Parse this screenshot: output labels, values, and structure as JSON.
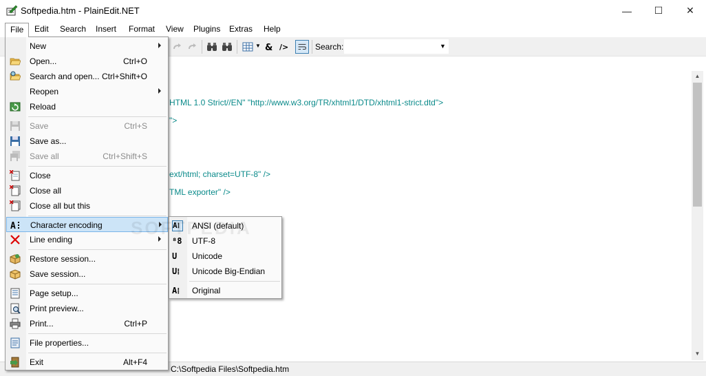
{
  "window": {
    "title": "Softpedia.htm - PlainEdit.NET",
    "minimize": "—",
    "maximize": "☐",
    "close": "✕"
  },
  "menubar": [
    "File",
    "Edit",
    "Search",
    "Insert",
    "Format",
    "View",
    "Plugins",
    "Extras",
    "Help"
  ],
  "toolbar": {
    "search_label": "Search:",
    "search_value": ""
  },
  "file_menu": {
    "items": [
      {
        "label": "New",
        "shortcut": "",
        "submenu": true,
        "disabled": false,
        "icon": "none"
      },
      {
        "label": "Open...",
        "shortcut": "Ctrl+O",
        "submenu": false,
        "disabled": false,
        "icon": "folder-open-icon"
      },
      {
        "label": "Search and open...",
        "shortcut": "Ctrl+Shift+O",
        "submenu": false,
        "disabled": false,
        "icon": "folder-search-icon"
      },
      {
        "label": "Reopen",
        "shortcut": "",
        "submenu": true,
        "disabled": false,
        "icon": "none"
      },
      {
        "label": "Reload",
        "shortcut": "",
        "submenu": false,
        "disabled": false,
        "icon": "reload-icon"
      },
      {
        "label": "Save",
        "shortcut": "Ctrl+S",
        "submenu": false,
        "disabled": true,
        "icon": "save-icon"
      },
      {
        "label": "Save as...",
        "shortcut": "",
        "submenu": false,
        "disabled": false,
        "icon": "save-as-icon"
      },
      {
        "label": "Save all",
        "shortcut": "Ctrl+Shift+S",
        "submenu": false,
        "disabled": true,
        "icon": "save-all-icon"
      },
      {
        "label": "Close",
        "shortcut": "",
        "submenu": false,
        "disabled": false,
        "icon": "close-doc-icon"
      },
      {
        "label": "Close all",
        "shortcut": "",
        "submenu": false,
        "disabled": false,
        "icon": "close-all-icon"
      },
      {
        "label": "Close all but this",
        "shortcut": "",
        "submenu": false,
        "disabled": false,
        "icon": "close-others-icon"
      },
      {
        "label": "Character encoding",
        "shortcut": "",
        "submenu": true,
        "disabled": false,
        "icon": "encoding-icon"
      },
      {
        "label": "Line ending",
        "shortcut": "",
        "submenu": true,
        "disabled": false,
        "icon": "line-ending-icon"
      },
      {
        "label": "Restore session...",
        "shortcut": "",
        "submenu": false,
        "disabled": false,
        "icon": "restore-session-icon"
      },
      {
        "label": "Save session...",
        "shortcut": "",
        "submenu": false,
        "disabled": false,
        "icon": "save-session-icon"
      },
      {
        "label": "Page setup...",
        "shortcut": "",
        "submenu": false,
        "disabled": false,
        "icon": "page-setup-icon"
      },
      {
        "label": "Print preview...",
        "shortcut": "",
        "submenu": false,
        "disabled": false,
        "icon": "print-preview-icon"
      },
      {
        "label": "Print...",
        "shortcut": "Ctrl+P",
        "submenu": false,
        "disabled": false,
        "icon": "print-icon"
      },
      {
        "label": "File properties...",
        "shortcut": "",
        "submenu": false,
        "disabled": false,
        "icon": "file-properties-icon"
      },
      {
        "label": "Exit",
        "shortcut": "Alt+F4",
        "submenu": false,
        "disabled": false,
        "icon": "exit-icon"
      }
    ]
  },
  "encoding_menu": {
    "items": [
      {
        "label": "ANSI (default)",
        "glyph": "A⁞",
        "checked": true
      },
      {
        "label": "UTF-8",
        "glyph": "⁸8",
        "checked": false
      },
      {
        "label": "Unicode",
        "glyph": "U",
        "checked": false
      },
      {
        "label": "Unicode Big-Endian",
        "glyph": "U⁞",
        "checked": false
      },
      {
        "label": "Original",
        "glyph": "A⁞",
        "checked": false
      }
    ]
  },
  "editor": {
    "visible_lines": [
      "HTML 1.0 Strict//EN\" \"http://www.w3.org/TR/xhtml1/DTD/xhtml1-strict.dtd\">",
      "\">",
      "ext/html; charset=UTF-8\" />",
      "TML exporter\" />"
    ]
  },
  "statusbar": {
    "path": "C:\\Softpedia Files\\Softpedia.htm"
  },
  "watermark": "SOFTPEDIA"
}
